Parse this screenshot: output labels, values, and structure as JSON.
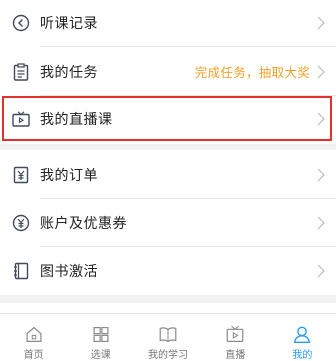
{
  "menu": {
    "group1": [
      {
        "label": "听课记录",
        "icon": "history-icon"
      },
      {
        "label": "我的任务",
        "icon": "task-clipboard-icon",
        "extra": "完成任务，抽取大奖"
      },
      {
        "label": "我的直播课",
        "icon": "tv-live-icon"
      }
    ],
    "group2": [
      {
        "label": "我的订单",
        "icon": "order-yen-icon"
      },
      {
        "label": "账户及优惠券",
        "icon": "coupon-yen-icon"
      },
      {
        "label": "图书激活",
        "icon": "book-icon"
      }
    ]
  },
  "tabbar": [
    {
      "label": "首页",
      "icon": "home-icon"
    },
    {
      "label": "选课",
      "icon": "grid-icon"
    },
    {
      "label": "我的学习",
      "icon": "open-book-icon"
    },
    {
      "label": "直播",
      "icon": "tv-icon"
    },
    {
      "label": "我的",
      "icon": "user-icon",
      "active": true
    }
  ],
  "colors": {
    "accent": "#2a9bf2",
    "icon": "#3f4b5b",
    "extra_text": "#f1a12a",
    "highlight": "#e5312b"
  }
}
